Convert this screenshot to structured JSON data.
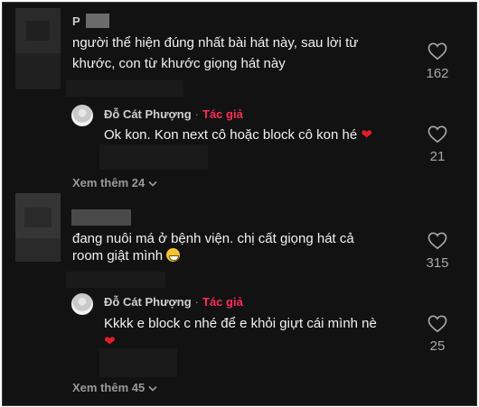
{
  "comments": [
    {
      "username": "P",
      "text_lines": [
        "người thể hiện đúng nhất bài hát này, sau lời từ",
        "khước, con từ khước giọng hát này"
      ],
      "likes": "162",
      "reply": {
        "username": "Đỗ Cát Phượng",
        "separator": "·",
        "author_label": "Tác giả",
        "text": "Ok kon. Kon next cô hoặc block cô kon hé",
        "emoji": "❤",
        "likes": "21"
      },
      "view_more": "Xem thêm 24"
    },
    {
      "username": "",
      "text_lines": [
        "đang nuôi má ở bệnh viện. chị cất giọng hát cả",
        "room giật mình"
      ],
      "likes": "315",
      "reply": {
        "username": "Đỗ Cát Phượng",
        "separator": "·",
        "author_label": "Tác giả",
        "text": "Kkkk e block c nhé để e khỏi giựt cái mình nè",
        "emoji": "❤",
        "likes": "25"
      },
      "view_more": "Xem thêm 45"
    }
  ],
  "colors": {
    "background": "#121212",
    "author_tag": "#fe2c55",
    "heart_emoji": "#e11d2a"
  },
  "icons": {
    "like": "heart-outline-icon",
    "expand": "chevron-down-icon"
  }
}
